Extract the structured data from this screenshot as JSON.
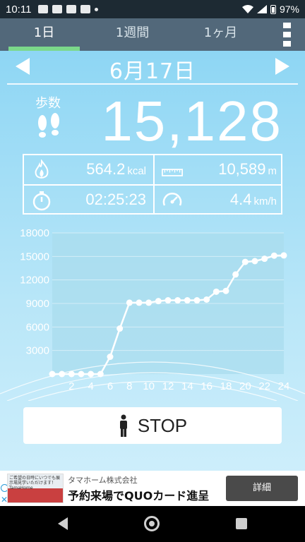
{
  "status_bar": {
    "time": "10:11",
    "battery": "97%"
  },
  "tabs": [
    {
      "label": "1日",
      "active": true
    },
    {
      "label": "1週間",
      "active": false
    },
    {
      "label": "1ヶ月",
      "active": false
    }
  ],
  "date": "6月17日",
  "steps": {
    "label": "歩数",
    "value": "15,128"
  },
  "stats": {
    "calories": {
      "value": "564.2",
      "unit": "kcal"
    },
    "distance": {
      "value": "10,589",
      "unit": "m"
    },
    "duration": {
      "value": "02:25:23",
      "unit": ""
    },
    "speed": {
      "value": "4.4",
      "unit": "km/h"
    }
  },
  "chart_data": {
    "type": "line",
    "title": "",
    "xlabel": "",
    "ylabel": "",
    "ylim": [
      0,
      18000
    ],
    "xlim": [
      0,
      24
    ],
    "y_ticks": [
      3000,
      6000,
      9000,
      12000,
      15000,
      18000
    ],
    "x_ticks": [
      2,
      4,
      6,
      8,
      10,
      12,
      14,
      16,
      18,
      20,
      22,
      24
    ],
    "grid": true,
    "colors": {
      "line": "#ffffff",
      "plot_bg": "#a9dcee",
      "grid": "#d4eef8"
    },
    "x": [
      0,
      1,
      2,
      3,
      4,
      5,
      6,
      7,
      8,
      9,
      10,
      11,
      12,
      13,
      14,
      15,
      16,
      17,
      18,
      19,
      20,
      21,
      22,
      23,
      24
    ],
    "series": [
      {
        "values": [
          0,
          0,
          0,
          0,
          0,
          0,
          2200,
          5800,
          9100,
          9100,
          9100,
          9300,
          9400,
          9400,
          9400,
          9400,
          9500,
          10500,
          10600,
          12700,
          14300,
          14400,
          14700,
          15100,
          15128
        ]
      }
    ]
  },
  "stop_button": {
    "label": "STOP"
  },
  "ad": {
    "image_text": "ご希望の日時にいつでも展示場見学いただけます！ TamaHome",
    "company": "タマホーム株式会社",
    "headline": "予約来場でQUOカード進呈",
    "button": "詳細"
  }
}
